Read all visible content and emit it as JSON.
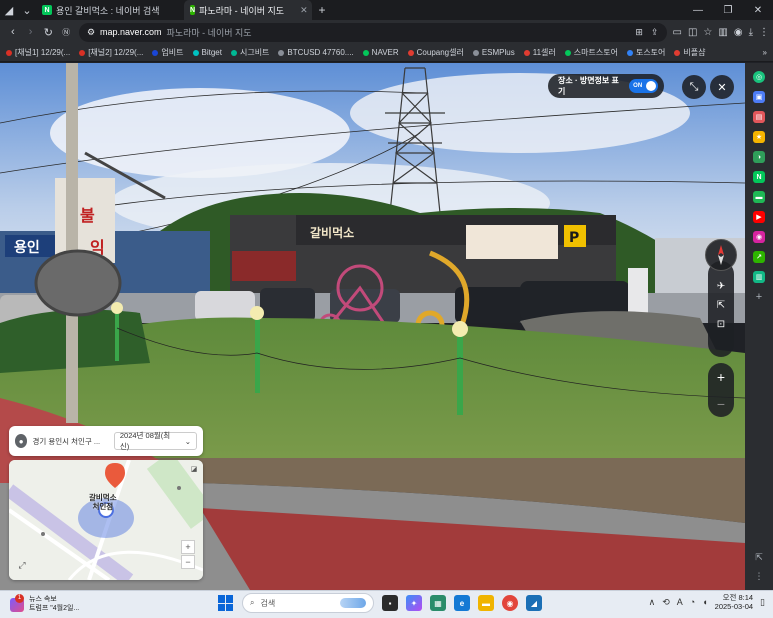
{
  "browser": {
    "tabs": [
      {
        "title": "용인 갈비먹소 : 네이버 검색",
        "favicon": "N",
        "favicon_color": "#03c75a",
        "active": false
      },
      {
        "title": "파노라마 - 네이버 지도",
        "favicon": "N",
        "favicon_color": "#2db400",
        "active": true
      }
    ],
    "new_tab": "+",
    "url_host": "map.naver.com",
    "url_title": "파노라마 - 네이버 지도",
    "window_controls": [
      "—",
      "❐",
      "✕"
    ]
  },
  "bookmarks": [
    {
      "label": "[채널1] 12/29(...",
      "color": "#d93025"
    },
    {
      "label": "[채널2] 12/29(...",
      "color": "#d93025"
    },
    {
      "label": "업비트",
      "color": "#1a46d6"
    },
    {
      "label": "Bitget",
      "color": "#00c2c2"
    },
    {
      "label": "시그비트",
      "color": "#00b894"
    },
    {
      "label": "BTCUSD 47760....",
      "color": "#8a8f98"
    },
    {
      "label": "NAVER",
      "color": "#03c75a"
    },
    {
      "label": "Coupang셀러",
      "color": "#e03c31"
    },
    {
      "label": "ESMPlus",
      "color": "#8a8f98"
    },
    {
      "label": "11셀러",
      "color": "#e03c31"
    },
    {
      "label": "스마트스토어",
      "color": "#03c75a"
    },
    {
      "label": "토스토어",
      "color": "#3182f6"
    },
    {
      "label": "비플샵",
      "color": "#e03c31"
    }
  ],
  "bookmarks_more": "»",
  "panorama": {
    "overlay_toggle_label": "장소 · 방면정보 표기",
    "overlay_toggle_state": "ON",
    "signs": {
      "shop_left_1": "용인",
      "shop_left_2": "불",
      "shop_left_3": "익",
      "restaurant_name": "갈비먹소",
      "parking": "P"
    },
    "location_card": {
      "address": "경기 용인시 처인구 ...",
      "date": "2024년 08월(최신)"
    },
    "minimap": {
      "place_name": "갈비먹소",
      "place_sub": "처인점",
      "zoom_in": "+",
      "zoom_out": "−"
    }
  },
  "taskbar": {
    "news_badge": "1",
    "news_title": "뉴스 속보",
    "news_sub": "트럼프 \"4월2일...",
    "search_placeholder": "검색",
    "tray_lang": "A",
    "time": "오전 8:14",
    "date": "2025-03-04"
  }
}
